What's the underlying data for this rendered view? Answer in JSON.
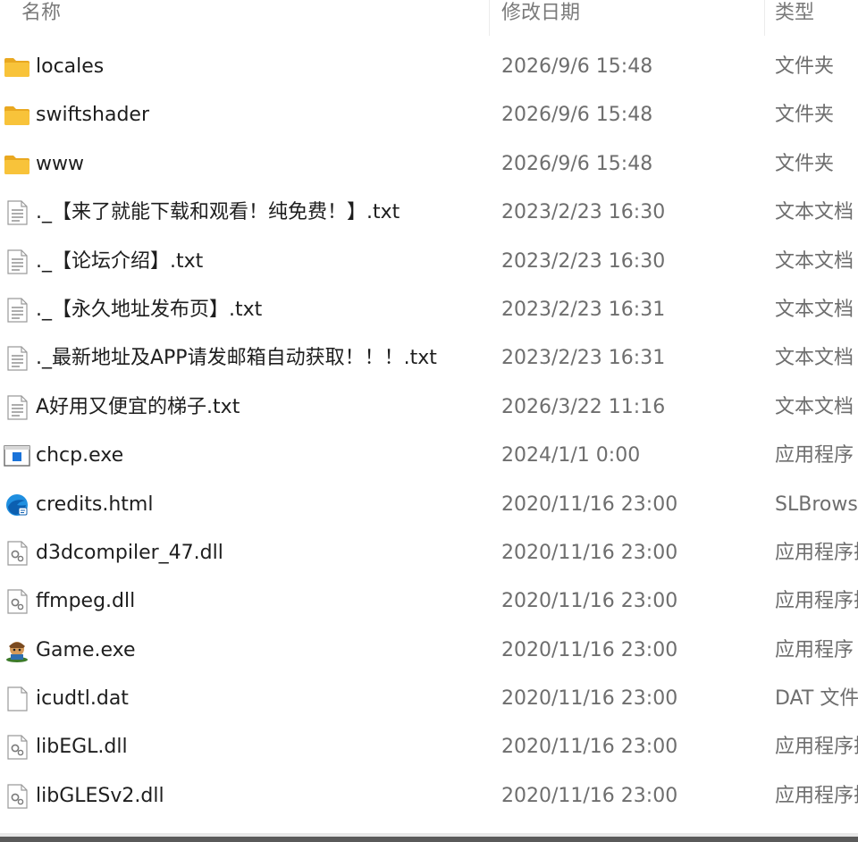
{
  "columns": {
    "name": "名称",
    "date": "修改日期",
    "type": "类型"
  },
  "files": [
    {
      "name": "locales",
      "date": "2026/9/6 15:48",
      "type": "文件夹",
      "icon": "folder-icon"
    },
    {
      "name": "swiftshader",
      "date": "2026/9/6 15:48",
      "type": "文件夹",
      "icon": "folder-icon"
    },
    {
      "name": "www",
      "date": "2026/9/6 15:48",
      "type": "文件夹",
      "icon": "folder-icon"
    },
    {
      "name": "._【来了就能下载和观看！纯免费！】.txt",
      "date": "2023/2/23 16:30",
      "type": "文本文档",
      "icon": "text-file-icon"
    },
    {
      "name": "._【论坛介绍】.txt",
      "date": "2023/2/23 16:30",
      "type": "文本文档",
      "icon": "text-file-icon"
    },
    {
      "name": "._【永久地址发布页】.txt",
      "date": "2023/2/23 16:31",
      "type": "文本文档",
      "icon": "text-file-icon"
    },
    {
      "name": "._最新地址及APP请发邮箱自动获取！！！.txt",
      "date": "2023/2/23 16:31",
      "type": "文本文档",
      "icon": "text-file-icon"
    },
    {
      "name": "A好用又便宜的梯子.txt",
      "date": "2026/3/22 11:16",
      "type": "文本文档",
      "icon": "text-file-icon"
    },
    {
      "name": "chcp.exe",
      "date": "2024/1/1 0:00",
      "type": "应用程序",
      "icon": "application-window-icon"
    },
    {
      "name": "credits.html",
      "date": "2020/11/16 23:00",
      "type": "SLBrowser",
      "icon": "browser-icon"
    },
    {
      "name": "d3dcompiler_47.dll",
      "date": "2020/11/16 23:00",
      "type": "应用程序扩展",
      "icon": "dll-file-icon"
    },
    {
      "name": "ffmpeg.dll",
      "date": "2020/11/16 23:00",
      "type": "应用程序扩展",
      "icon": "dll-file-icon"
    },
    {
      "name": "Game.exe",
      "date": "2020/11/16 23:00",
      "type": "应用程序",
      "icon": "game-app-icon"
    },
    {
      "name": "icudtl.dat",
      "date": "2020/11/16 23:00",
      "type": "DAT 文件",
      "icon": "blank-file-icon"
    },
    {
      "name": "libEGL.dll",
      "date": "2020/11/16 23:00",
      "type": "应用程序扩展",
      "icon": "dll-file-icon"
    },
    {
      "name": "libGLESv2.dll",
      "date": "2020/11/16 23:00",
      "type": "应用程序扩展",
      "icon": "dll-file-icon"
    }
  ],
  "colors": {
    "folder": "#f8c33a",
    "text_primary": "#1e1e1e",
    "text_secondary": "#6e6e6e",
    "header_text": "#7a7a7a"
  }
}
